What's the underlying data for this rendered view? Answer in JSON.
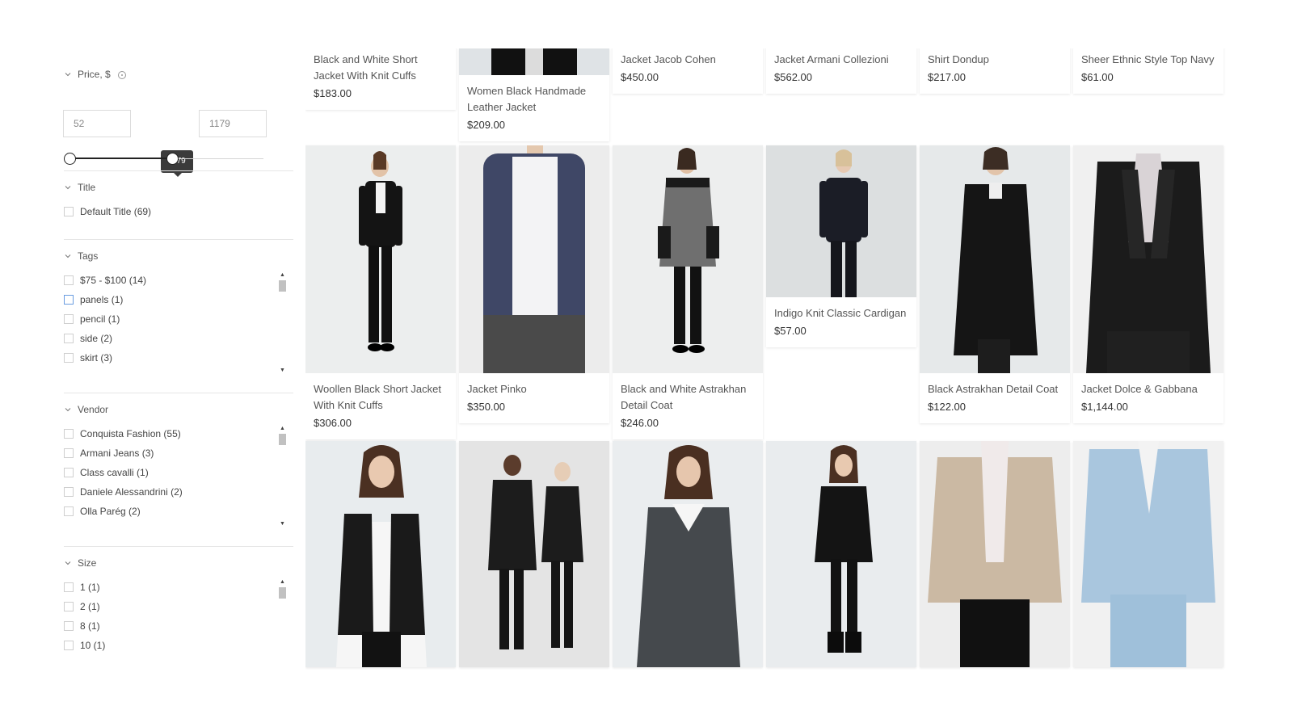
{
  "sidebar": {
    "price": {
      "label": "Price, $",
      "min_value": "52",
      "max_value": "1179",
      "tooltip": "1179",
      "range_fraction": [
        0.0,
        0.53
      ]
    },
    "title_filter": {
      "label": "Title",
      "options": [
        {
          "label": "Default Title (69)"
        }
      ]
    },
    "tags_filter": {
      "label": "Tags",
      "options": [
        {
          "label": "$75 - $100 (14)"
        },
        {
          "label": "panels (1)"
        },
        {
          "label": "pencil (1)"
        },
        {
          "label": "side (2)"
        },
        {
          "label": "skirt (3)"
        }
      ]
    },
    "vendor_filter": {
      "label": "Vendor",
      "options": [
        {
          "label": "Conquista Fashion (55)"
        },
        {
          "label": "Armani Jeans (3)"
        },
        {
          "label": "Class cavalli (1)"
        },
        {
          "label": "Daniele Alessandrini (2)"
        },
        {
          "label": "Olla Parég (2)"
        }
      ]
    },
    "size_filter": {
      "label": "Size",
      "options": [
        {
          "label": "1 (1)"
        },
        {
          "label": "2 (1)"
        },
        {
          "label": "8 (1)"
        },
        {
          "label": "10 (1)"
        }
      ]
    }
  },
  "products": {
    "row1": [
      {
        "name": "Black and White Short Jacket With Knit Cuffs",
        "price": "$183.00"
      },
      {
        "name": "Women Black Handmade Leather Jacket",
        "price": "$209.00"
      },
      {
        "name": "Jacket Jacob Cohen",
        "price": "$450.00"
      },
      {
        "name": "Jacket Armani Collezioni",
        "price": "$562.00"
      },
      {
        "name": "Shirt Dondup",
        "price": "$217.00"
      },
      {
        "name": "Sheer Ethnic Style Top Navy",
        "price": "$61.00"
      }
    ],
    "row2": [
      {
        "name": "Woollen Black Short Jacket With Knit Cuffs",
        "price": "$306.00"
      },
      {
        "name": "Jacket Pinko",
        "price": "$350.00"
      },
      {
        "name": "Black and White Astrakhan Detail Coat",
        "price": "$246.00"
      },
      {
        "name": "Indigo Knit Classic Cardigan",
        "price": "$57.00"
      },
      {
        "name": "Black Astrakhan Detail Coat",
        "price": "$122.00"
      },
      {
        "name": "Jacket Dolce & Gabbana",
        "price": "$1,144.00"
      }
    ]
  },
  "colors": {
    "accent_focus": "#6a9ce0",
    "tooltip_bg": "#3b3b3b",
    "image_bg": "#e9ecee"
  }
}
